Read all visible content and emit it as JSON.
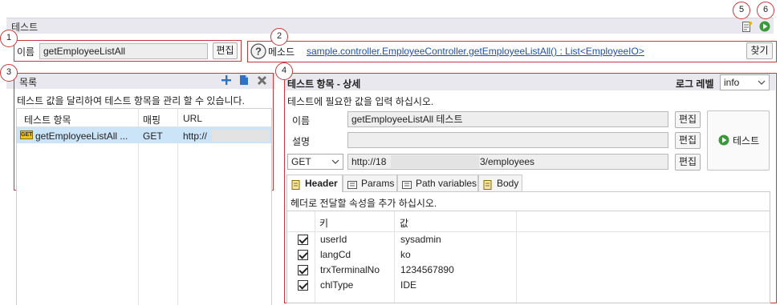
{
  "titlebar": {
    "title": "테스트"
  },
  "callouts": [
    "1",
    "2",
    "3",
    "4",
    "5",
    "6"
  ],
  "name_row": {
    "label": "이름",
    "value": "getEmployeeListAll",
    "edit_button": "편집"
  },
  "method_row": {
    "help_icon": "question-circle-icon",
    "label": "메소드",
    "link": "sample.controller.EmployeeController.getEmployeeListAll() : List<EmployeeIO>",
    "find_button": "찾기"
  },
  "list_panel": {
    "title": "목록",
    "description": "테스트 값을 달리하여 테스트 항목을 관리 할 수 있습니다.",
    "columns": [
      "테스트 항목",
      "매핑",
      "URL"
    ],
    "rows": [
      {
        "badge": "GET",
        "name": "getEmployeeListAll ...",
        "mapping": "GET",
        "url": "http://"
      }
    ]
  },
  "detail_panel": {
    "title": "테스트 항목 - 상세",
    "log_level_label": "로그 레벨",
    "log_level_value": "info",
    "description": "테스트에 필요한 값을 입력 하십시오.",
    "name_label": "이름",
    "name_value": "getEmployeeListAll 테스트",
    "desc_label": "설명",
    "desc_value": "",
    "method_value": "GET",
    "url_prefix": "http://18",
    "url_suffix": "3/employees",
    "edit_button": "편집",
    "test_button": "테스트",
    "tabs": [
      "Header",
      "Params",
      "Path variables",
      "Body"
    ],
    "header_hint": "헤더로 전달할 속성을 추가 하십시오.",
    "header_columns": [
      "키",
      "값"
    ],
    "header_rows": [
      {
        "key": "userId",
        "value": "sysadmin",
        "checked": true
      },
      {
        "key": "langCd",
        "value": "ko",
        "checked": true
      },
      {
        "key": "trxTerminalNo",
        "value": "1234567890",
        "checked": true
      },
      {
        "key": "chlType",
        "value": "IDE",
        "checked": true
      }
    ]
  },
  "colors": {
    "accent": "#1f4fa8",
    "callout": "#c7393c",
    "run_green": "#3a9a3a"
  }
}
